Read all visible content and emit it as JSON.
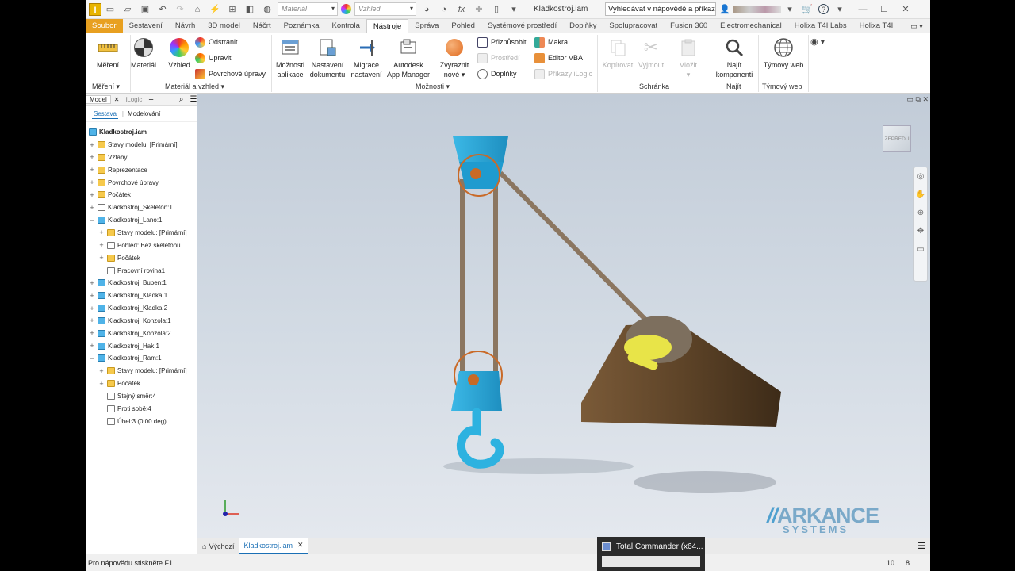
{
  "titlebar": {
    "material_placeholder": "Materiál",
    "appearance_placeholder": "Vzhled",
    "doc_title": "Kladkostroj.iam",
    "search_text": "Vyhledávat v nápovědě a příkaz"
  },
  "tabs": [
    "Soubor",
    "Sestavení",
    "Návrh",
    "3D model",
    "Náčrt",
    "Poznámka",
    "Kontrola",
    "Nástroje",
    "Správa",
    "Pohled",
    "Systémové prostředí",
    "Doplňky",
    "Spolupracovat",
    "Fusion 360",
    "Electromechanical",
    "Holixa T4I Labs",
    "Holixa T4I"
  ],
  "ribbon": {
    "measure": "Měření",
    "material": "Materiál",
    "appearance": "Vzhled",
    "remove": "Odstranit",
    "adjust": "Upravit",
    "finishes": "Povrchové úpravy",
    "app_options_1": "Možnosti",
    "app_options_2": "aplikace",
    "doc_settings_1": "Nastavení",
    "doc_settings_2": "dokumentu",
    "migrate_1": "Migrace",
    "migrate_2": "nastavení",
    "appmgr_1": "Autodesk",
    "appmgr_2": "App Manager",
    "highlight_1": "Zvýraznit",
    "highlight_2": "nové",
    "customize": "Přizpůsobit",
    "environments": "Prostředí",
    "addins": "Doplňky",
    "macros": "Makra",
    "vba": "Editor VBA",
    "ilogic": "Příkazy iLogic",
    "copy": "Kopírovat",
    "cut": "Vyjmout",
    "paste": "Vložit",
    "find_1": "Najít",
    "find_2": "komponenti",
    "teamweb": "Týmový web",
    "groups": {
      "measure": "Měření",
      "material": "Materiál a vzhled",
      "options": "Možnosti",
      "clipboard": "Schránka",
      "find": "Najít",
      "web": "Týmový web"
    }
  },
  "browser": {
    "tab_model": "Model",
    "tab_ilogic": "iLogic",
    "sub_assembly": "Sestava",
    "sub_modeling": "Modelování",
    "root": "Kladkostroj.iam",
    "items": [
      {
        "label": "Stavy modelu: [Primární]",
        "type": "folder",
        "level": 1,
        "pm": "+"
      },
      {
        "label": "Vztahy",
        "type": "folder",
        "level": 1,
        "pm": "+"
      },
      {
        "label": "Reprezentace",
        "type": "folder",
        "level": 1,
        "pm": "+"
      },
      {
        "label": "Povrchové úpravy",
        "type": "folder",
        "level": 1,
        "pm": "+"
      },
      {
        "label": "Počátek",
        "type": "folder",
        "level": 1,
        "pm": "+"
      },
      {
        "label": "Kladkostroj_Skeleton:1",
        "type": "other",
        "level": 1,
        "pm": "+"
      },
      {
        "label": "Kladkostroj_Lano:1",
        "type": "part",
        "level": 1,
        "pm": "−"
      },
      {
        "label": "Stavy modelu: [Primární]",
        "type": "folder",
        "level": 2,
        "pm": "+"
      },
      {
        "label": "Pohled: Bez skeletonu",
        "type": "other",
        "level": 2,
        "pm": "+"
      },
      {
        "label": "Počátek",
        "type": "folder",
        "level": 2,
        "pm": "+"
      },
      {
        "label": "Pracovní rovina1",
        "type": "other",
        "level": 2,
        "pm": ""
      },
      {
        "label": "Kladkostroj_Buben:1",
        "type": "part",
        "level": 1,
        "pm": "+"
      },
      {
        "label": "Kladkostroj_Kladka:1",
        "type": "part",
        "level": 1,
        "pm": "+"
      },
      {
        "label": "Kladkostroj_Kladka:2",
        "type": "part",
        "level": 1,
        "pm": "+"
      },
      {
        "label": "Kladkostroj_Konzola:1",
        "type": "part",
        "level": 1,
        "pm": "+"
      },
      {
        "label": "Kladkostroj_Konzola:2",
        "type": "part",
        "level": 1,
        "pm": "+"
      },
      {
        "label": "Kladkostroj_Hak:1",
        "type": "part",
        "level": 1,
        "pm": "+"
      },
      {
        "label": "Kladkostroj_Ram:1",
        "type": "part",
        "level": 1,
        "pm": "−"
      },
      {
        "label": "Stavy modelu: [Primární]",
        "type": "folder",
        "level": 2,
        "pm": "+"
      },
      {
        "label": "Počátek",
        "type": "folder",
        "level": 2,
        "pm": "+"
      },
      {
        "label": "Stejný směr:4",
        "type": "other",
        "level": 2,
        "pm": ""
      },
      {
        "label": "Proti sobě:4",
        "type": "other",
        "level": 2,
        "pm": ""
      },
      {
        "label": "Úhel:3 (0,00 deg)",
        "type": "other",
        "level": 2,
        "pm": ""
      }
    ]
  },
  "viewport": {
    "viewcube_label": "ZEPŘEDU",
    "logo_main": "ARKANCE",
    "logo_sub": "SYSTEMS"
  },
  "doctabs": {
    "home": "Výchozí",
    "doc": "Kladkostroj.iam"
  },
  "status": {
    "help": "Pro nápovědu stiskněte F1",
    "num1": "10",
    "num2": "8"
  },
  "taskbar": {
    "title": "Total Commander (x64..."
  }
}
